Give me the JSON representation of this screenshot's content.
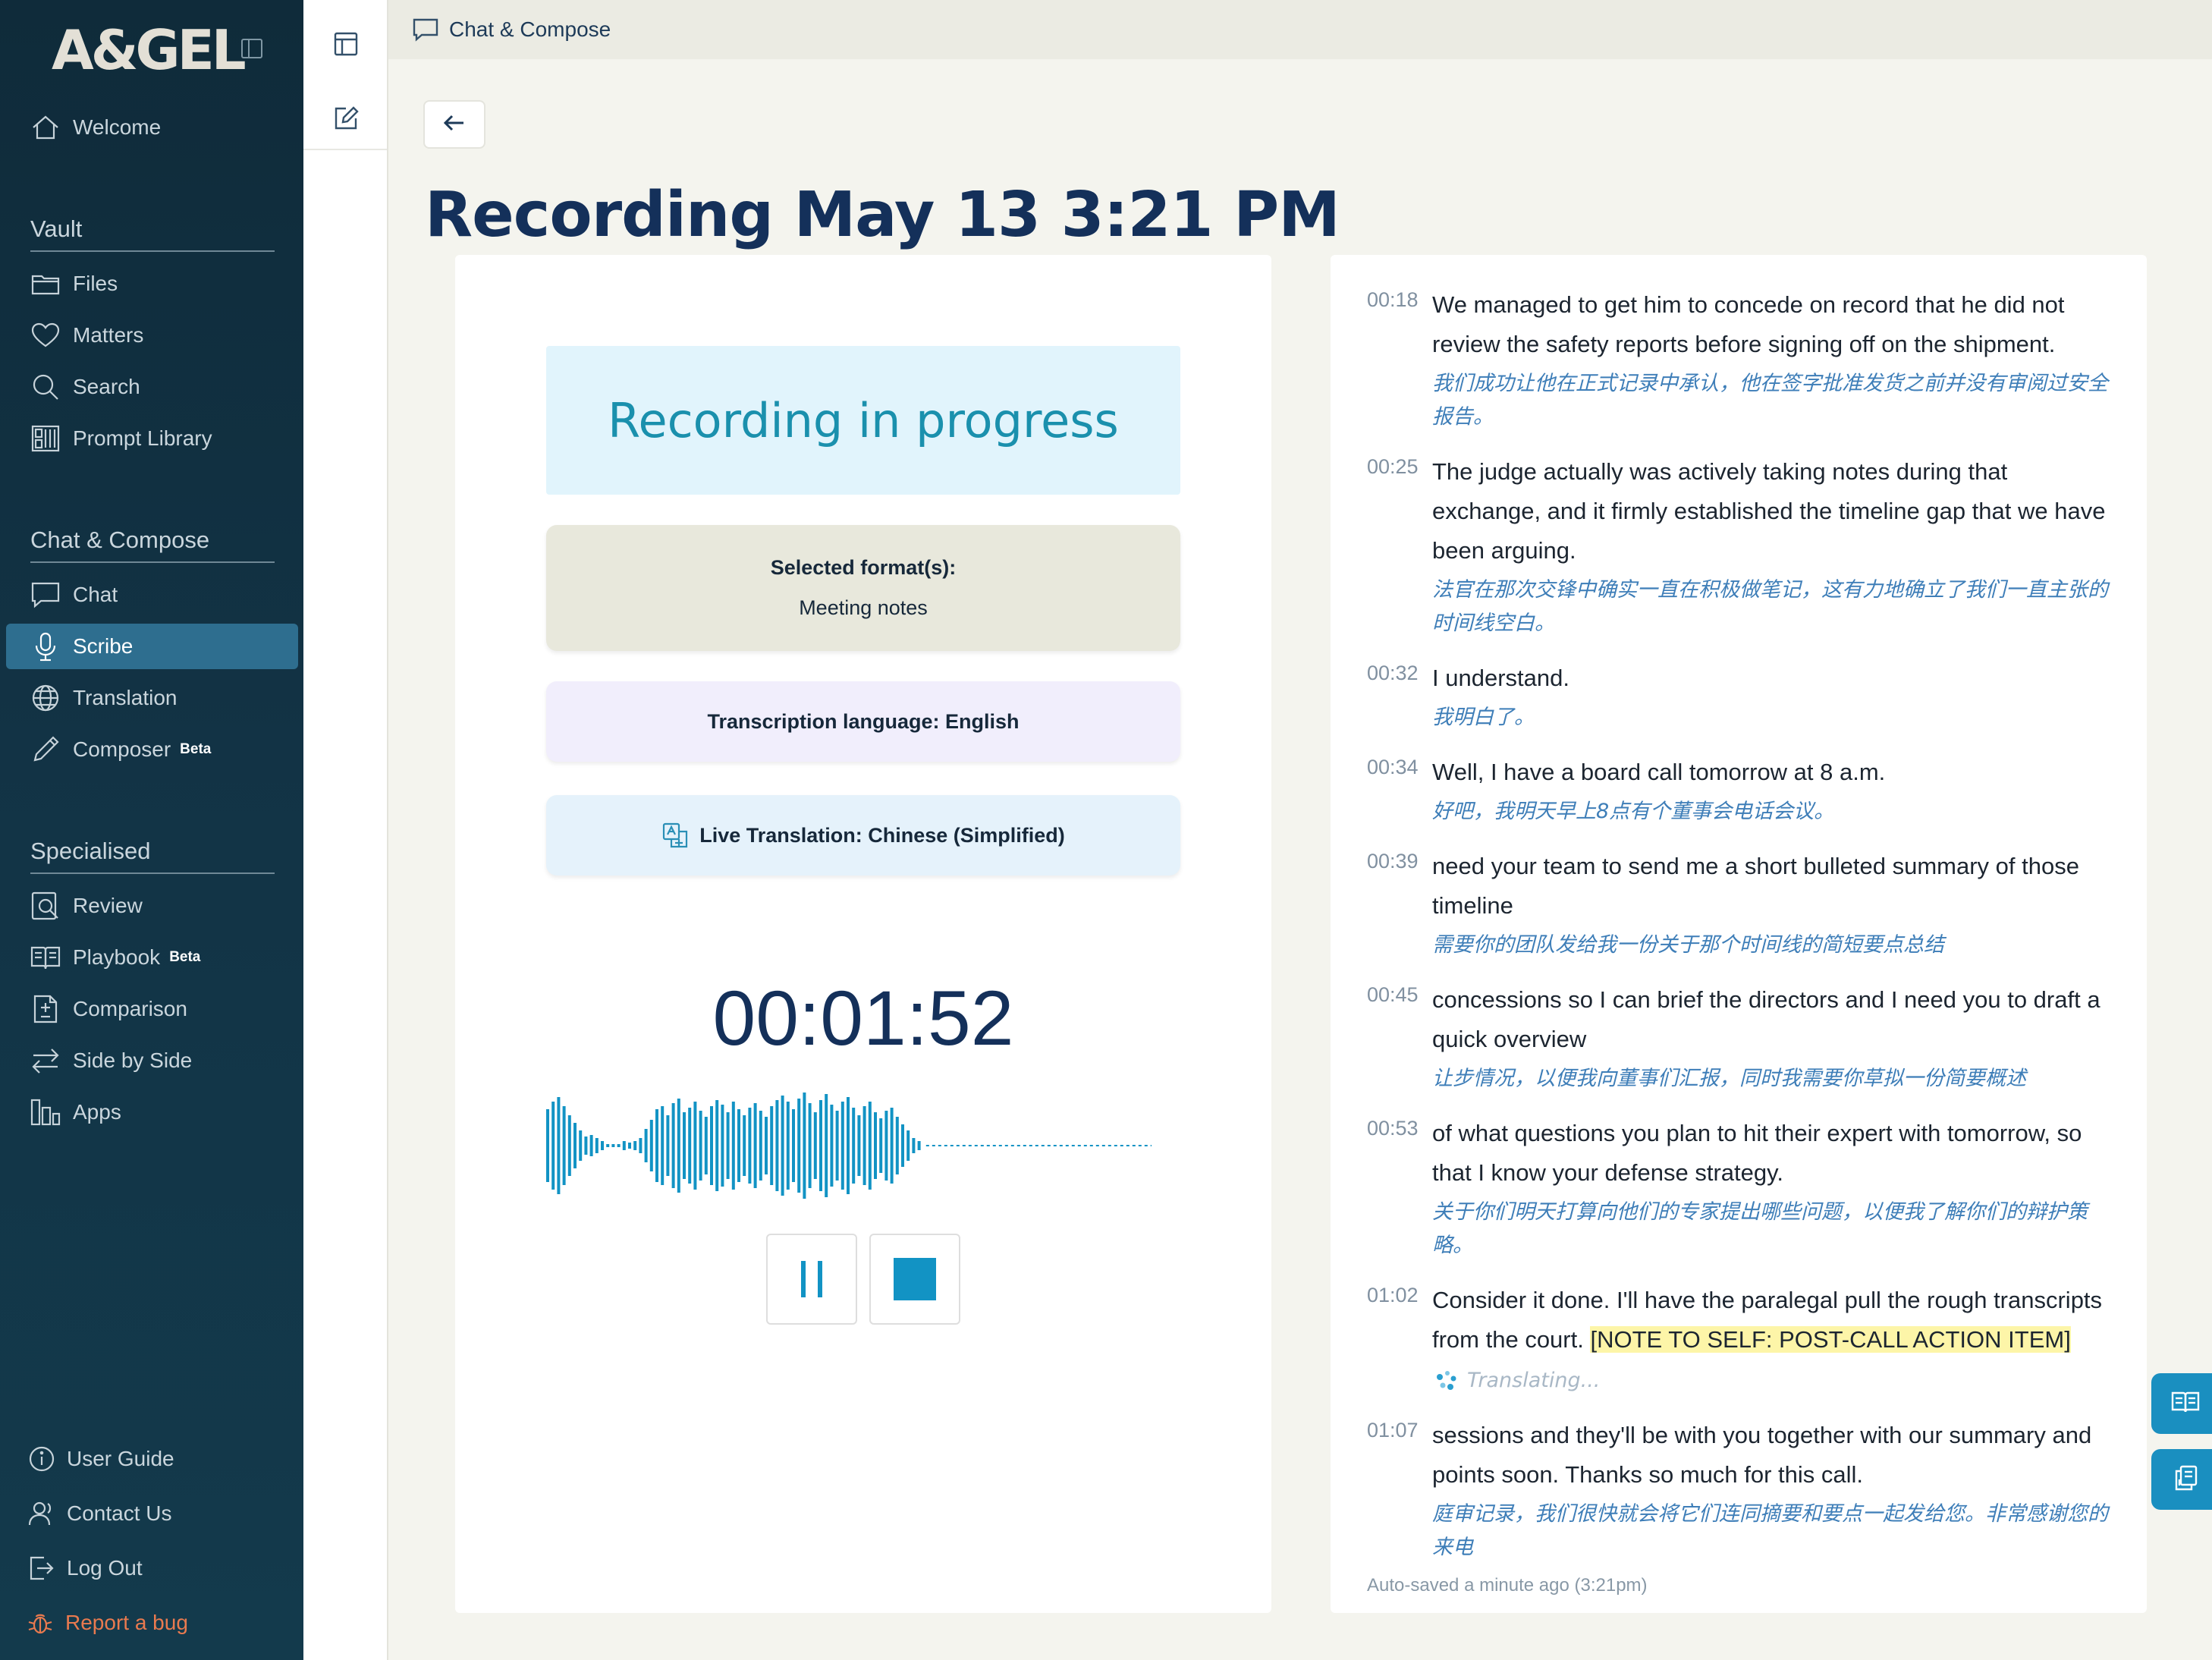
{
  "app": {
    "logo": "A&GEL"
  },
  "sidebar": {
    "welcome": "Welcome",
    "sections": [
      {
        "title": "Vault",
        "items": [
          {
            "label": "Files",
            "icon": "folder-icon"
          },
          {
            "label": "Matters",
            "icon": "heart-icon"
          },
          {
            "label": "Search",
            "icon": "search-icon"
          },
          {
            "label": "Prompt Library",
            "icon": "library-icon"
          }
        ]
      },
      {
        "title": "Chat & Compose",
        "items": [
          {
            "label": "Chat",
            "icon": "chat-icon"
          },
          {
            "label": "Scribe",
            "icon": "microphone-icon",
            "active": true
          },
          {
            "label": "Translation",
            "icon": "globe-icon"
          },
          {
            "label": "Composer",
            "icon": "pen-icon",
            "badge": "Beta"
          }
        ]
      },
      {
        "title": "Specialised",
        "items": [
          {
            "label": "Review",
            "icon": "review-icon"
          },
          {
            "label": "Playbook",
            "icon": "book-icon",
            "badge": "Beta"
          },
          {
            "label": "Comparison",
            "icon": "document-compare-icon"
          },
          {
            "label": "Side by Side",
            "icon": "swap-arrows-icon"
          },
          {
            "label": "Apps",
            "icon": "apps-icon"
          }
        ]
      }
    ],
    "bottom": {
      "user_guide": "User Guide",
      "contact_us": "Contact Us",
      "log_out": "Log Out",
      "report_bug": "Report a bug"
    }
  },
  "topbar": {
    "breadcrumb": "Chat & Compose"
  },
  "page": {
    "title": "Recording May 13 3:21 PM"
  },
  "recorder": {
    "status": "Recording in progress",
    "format_label": "Selected format(s):",
    "format_value": "Meeting notes",
    "language": "Transcription language: English",
    "live_translation": "Live Translation: Chinese (Simplified)",
    "timer": "00:01:52",
    "accent_color": "#1293c4"
  },
  "transcript": {
    "segments": [
      {
        "time": "00:18",
        "text": "We managed to get him to concede on record that he did not review the safety reports before signing off on the shipment.",
        "translation": "我们成功让他在正式记录中承认，他在签字批准发货之前并没有审阅过安全报告。"
      },
      {
        "time": "00:25",
        "text": "The judge actually was actively taking notes during that exchange, and it firmly established the timeline gap that we have been arguing.",
        "translation": "法官在那次交锋中确实一直在积极做笔记，这有力地确立了我们一直主张的时间线空白。"
      },
      {
        "time": "00:32",
        "text": "I understand.",
        "translation": "我明白了。"
      },
      {
        "time": "00:34",
        "text": "Well, I have a board call tomorrow at 8 a.m.",
        "translation": "好吧，我明天早上8点有个董事会电话会议。"
      },
      {
        "time": "00:39",
        "text": "need your team to send me a short bulleted summary of those timeline",
        "translation": "需要你的团队发给我一份关于那个时间线的简短要点总结"
      },
      {
        "time": "00:45",
        "text": "concessions so I can brief the directors and I need you to draft a quick overview",
        "translation": "让步情况，以便我向董事们汇报，同时我需要你草拟一份简要概述"
      },
      {
        "time": "00:53",
        "text": "of what questions you plan to hit their expert with tomorrow, so that I know your defense strategy.",
        "translation": "关于你们明天打算向他们的专家提出哪些问题，以便我了解你们的辩护策略。"
      },
      {
        "time": "01:02",
        "text": "Consider it done. I'll have the paralegal pull the rough transcripts from the court.",
        "highlight": "[NOTE TO SELF: POST-CALL ACTION ITEM]",
        "status": "Translating..."
      },
      {
        "time": "01:07",
        "text": "sessions and they'll be with you together with our summary and points soon. Thanks so much for this call.",
        "translation": "庭审记录，我们很快就会将它们连同摘要和要点一起发给您。非常感谢您的来电"
      }
    ],
    "autosave": "Auto-saved a minute ago (3:21pm)"
  }
}
